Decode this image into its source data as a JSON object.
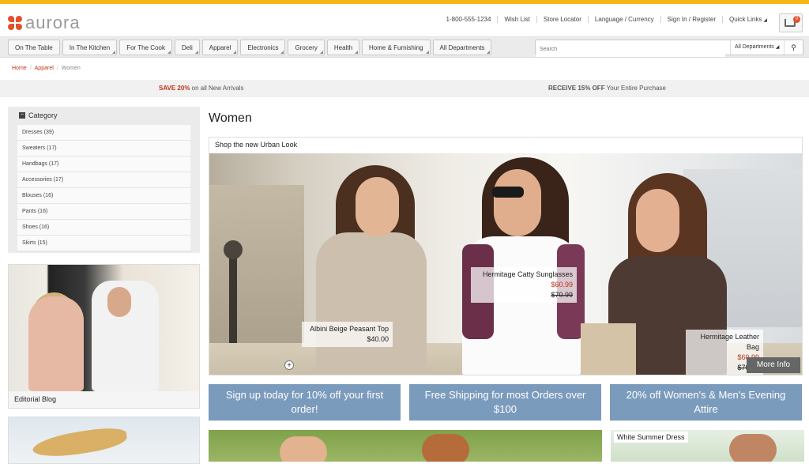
{
  "brand": {
    "name": "aurora"
  },
  "header": {
    "phone": "1-800-555-1234",
    "wishlist": "Wish List",
    "store_locator": "Store Locator",
    "language_currency": "Language / Currency",
    "sign_in": "Sign In / Register",
    "quick_links": "Quick Links",
    "cart_count": "0"
  },
  "nav": {
    "tabs": [
      {
        "label": "On The Table"
      },
      {
        "label": "In The Kitchen"
      },
      {
        "label": "For The Cook"
      },
      {
        "label": "Deli"
      },
      {
        "label": "Apparel"
      },
      {
        "label": "Electronics"
      },
      {
        "label": "Grocery"
      },
      {
        "label": "Health"
      },
      {
        "label": "Home & Furnishing"
      },
      {
        "label": "All Departments"
      }
    ],
    "search_placeholder": "Search",
    "search_department": "All Departments"
  },
  "breadcrumb": {
    "home": "Home",
    "apparel": "Apparel",
    "current": "Women"
  },
  "promobar": {
    "left_bold": "SAVE 20%",
    "left_rest": " on all New Arrivals",
    "right_bold": "RECEIVE 15% OFF",
    "right_rest": " Your Entire Purchase"
  },
  "sidebar": {
    "category_title": "Category",
    "categories": [
      {
        "label": "Dresses (39)"
      },
      {
        "label": "Sweaters (17)"
      },
      {
        "label": "Handbags (17)"
      },
      {
        "label": "Accessories (17)"
      },
      {
        "label": "Blouses (16)"
      },
      {
        "label": "Pants (16)"
      },
      {
        "label": "Shoes (16)"
      },
      {
        "label": "Skirts (15)"
      }
    ],
    "editorial_label": "Editorial Blog"
  },
  "main": {
    "title": "Women",
    "hero_caption": "Shop the new Urban Look",
    "products": [
      {
        "name": "Albini Beige Peasant Top",
        "price": "$40.00"
      },
      {
        "name": "Hermitage Catty Sunglasses",
        "sale_price": "$60.99",
        "orig_price": "$70.99"
      },
      {
        "name": "Hermitage Leather Bag",
        "sale_price": "$60.99",
        "orig_price": "$70.99"
      }
    ],
    "more_info": "More Info",
    "promo_tiles": [
      {
        "label": "Sign up today for 10% off your first order!"
      },
      {
        "label": "Free Shipping for most Orders over $100"
      },
      {
        "label": "20% off Women's & Men's Evening Attire"
      }
    ],
    "bottom_label": "White Summer Dress"
  },
  "colors": {
    "accent": "#f7b718",
    "brand": "#e4502c",
    "sale": "#c0321b",
    "promo_tile": "#7b9bbd"
  }
}
